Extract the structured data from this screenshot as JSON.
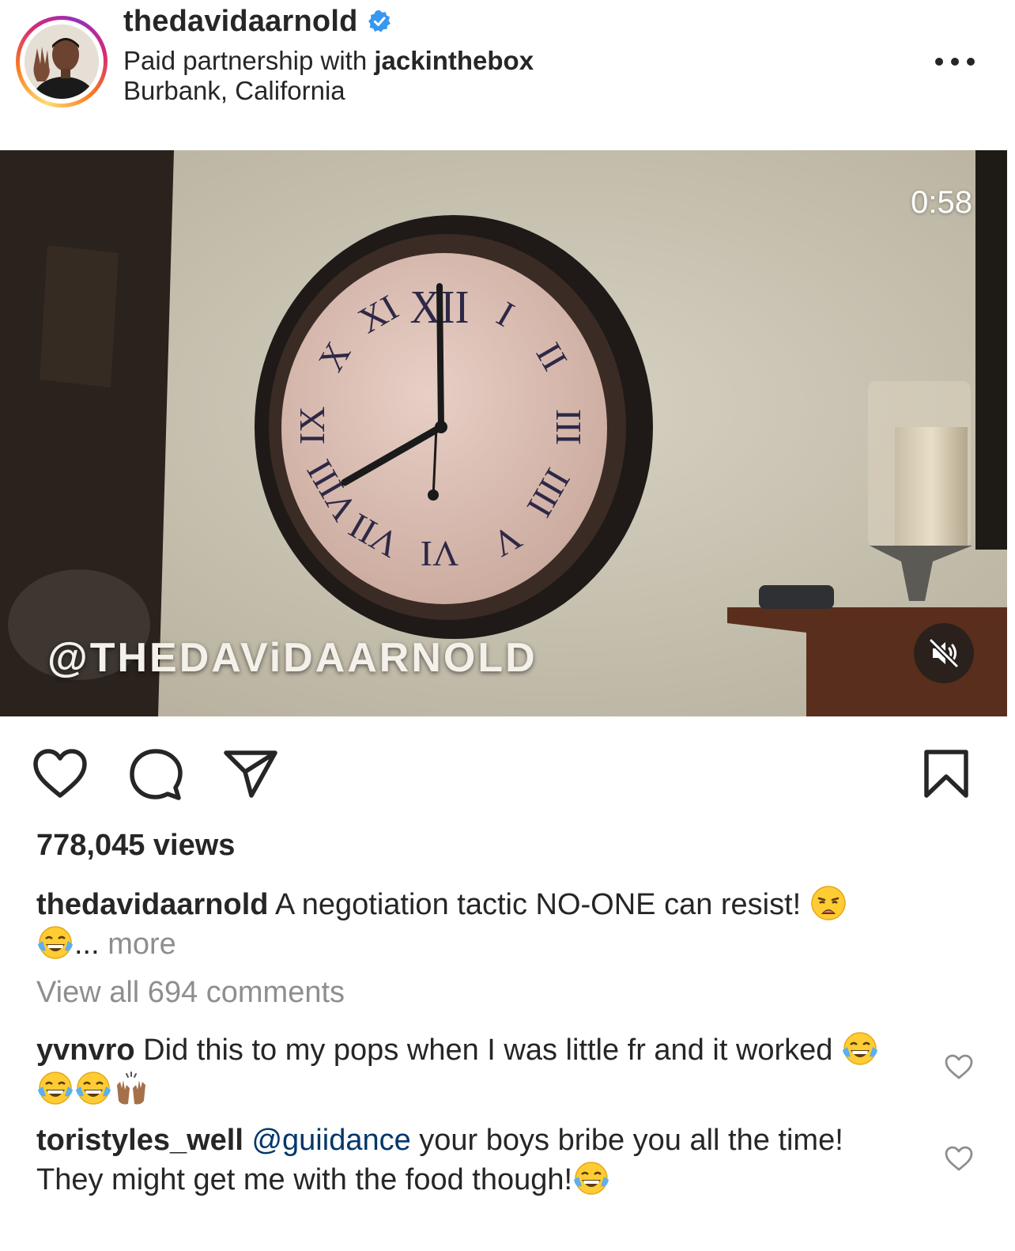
{
  "header": {
    "username": "thedavidaarnold",
    "verified": true,
    "partnership_prefix": "Paid partnership with ",
    "partner": "jackinthebox",
    "location": "Burbank, California",
    "more_icon": "more-horizontal-icon"
  },
  "video": {
    "duration": "0:58",
    "watermark": "@THEDAViDAARNOLD",
    "muted": true,
    "mute_icon": "speaker-muted-icon"
  },
  "actions": {
    "like_icon": "heart-icon",
    "comment_icon": "comment-bubble-icon",
    "share_icon": "paper-plane-icon",
    "save_icon": "bookmark-icon"
  },
  "views": "778,045 views",
  "caption": {
    "username": "thedavidaarnold",
    "text": " A negotiation tactic NO-ONE can resist! ",
    "ellipsis": "... ",
    "more": "more",
    "emojis": [
      "weary-face",
      "tears-of-joy"
    ]
  },
  "view_all_comments": "View all 694 comments",
  "comments": [
    {
      "username": "yvnvro",
      "text_before": " Did this to my pops when I was little fr and it worked ",
      "mention": "",
      "text_after": "",
      "emojis": [
        "tears-of-joy",
        "tears-of-joy",
        "tears-of-joy",
        "raising-hands"
      ]
    },
    {
      "username": "toristyles_well",
      "text_before": " ",
      "mention": "@guiidance",
      "text_after": " your boys bribe you all the time! They might get me with the food though!",
      "emojis": [
        "tears-of-joy"
      ]
    }
  ],
  "colors": {
    "text": "#262626",
    "secondary": "#8e8e8e",
    "verified_blue": "#3897f0",
    "mention": "#00376b"
  }
}
